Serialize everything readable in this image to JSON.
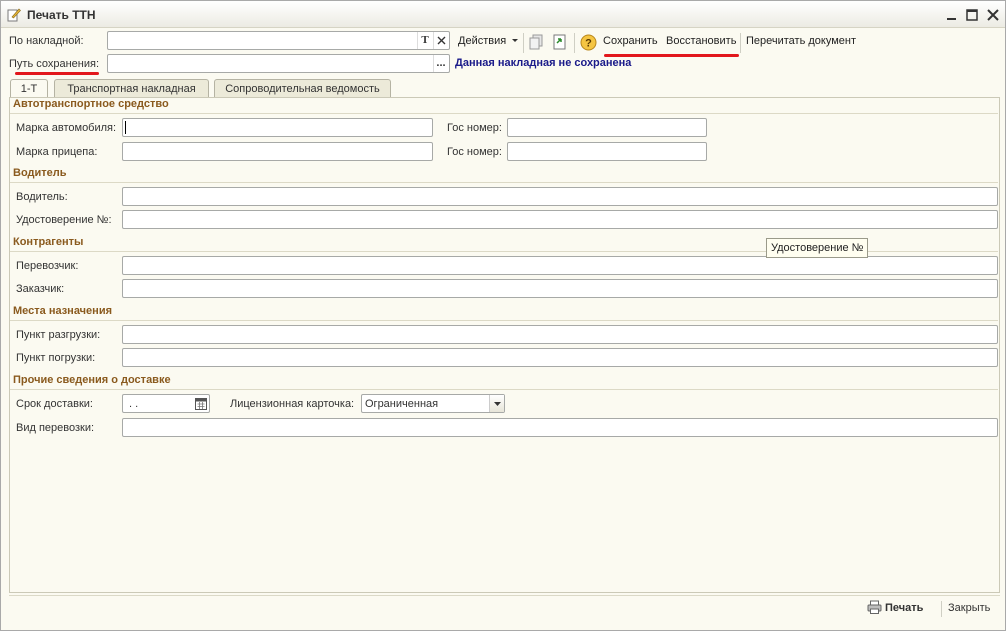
{
  "window": {
    "title": "Печать ТТН"
  },
  "header": {
    "invoice_label": "По накладной:",
    "invoice_value": "",
    "save_path_label": "Путь сохранения:",
    "save_path_value": "",
    "browse_label": "...",
    "status_message": "Данная накладная не сохранена"
  },
  "toolbar": {
    "actions_label": "Действия",
    "help_label": "?",
    "save_label": "Сохранить",
    "restore_label": "Восстановить",
    "reread_label": "Перечитать документ"
  },
  "tabs": [
    {
      "label": "1-Т"
    },
    {
      "label": "Транспортная накладная"
    },
    {
      "label": "Сопроводительная ведомость"
    }
  ],
  "form": {
    "section_vehicle": "Автотранспортное средство",
    "car_brand_label": "Марка автомобиля:",
    "car_plate_label": "Гос номер:",
    "trailer_brand_label": "Марка прицепа:",
    "trailer_plate_label": "Гос номер:",
    "section_driver": "Водитель",
    "driver_label": "Водитель:",
    "license_label": "Удостоверение №:",
    "section_counterparties": "Контрагенты",
    "carrier_label": "Перевозчик:",
    "customer_label": "Заказчик:",
    "section_destinations": "Места назначения",
    "unload_point_label": "Пункт разгрузки:",
    "load_point_label": "Пункт погрузки:",
    "section_other": "Прочие сведения о доставке",
    "delivery_term_label": "Срок доставки:",
    "delivery_term_value": " .  .",
    "license_card_label": "Лицензионная карточка:",
    "license_card_value": "Ограниченная",
    "transport_type_label": "Вид перевозки:"
  },
  "tooltip": {
    "text": "Удостоверение №"
  },
  "footer": {
    "print_label": "Печать",
    "close_label": "Закрыть"
  },
  "colors": {
    "section_heading": "#8a5a1e",
    "status_message": "#1a1a8a",
    "annotation_red": "#e2171c"
  }
}
